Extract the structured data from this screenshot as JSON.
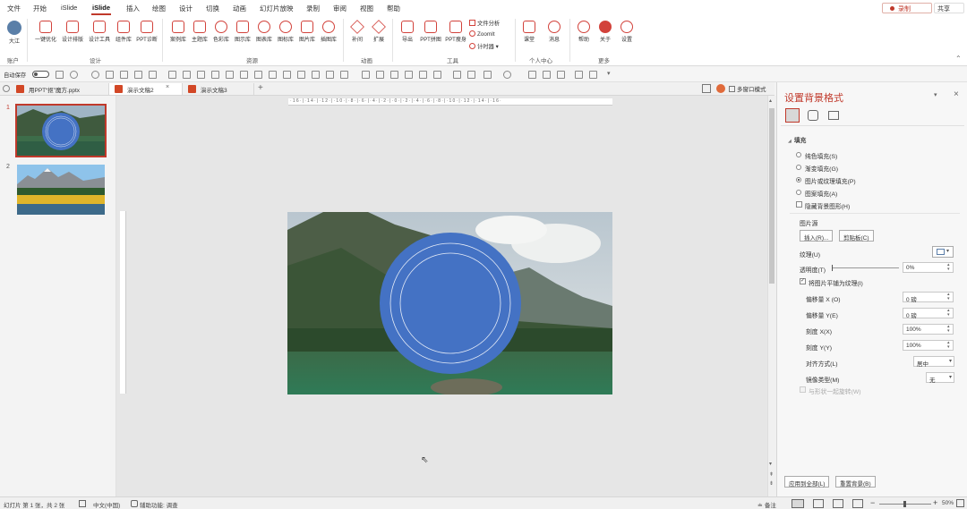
{
  "menu": {
    "tabs": [
      "文件",
      "开始",
      "iSlide",
      "iSlide",
      "插入",
      "绘图",
      "设计",
      "切换",
      "动画",
      "幻灯片放映",
      "录制",
      "审阅",
      "视图",
      "帮助"
    ],
    "record": "录制",
    "share": "共享"
  },
  "ribbon": {
    "account_btn": "大江",
    "buttons": [
      "一键优化",
      "设计排版",
      "设计工具",
      "组件库",
      "PPT诊断",
      "案例库",
      "主题库",
      "色彩库",
      "图示库",
      "图表库",
      "图标库",
      "图片库",
      "插图库",
      "补间",
      "扩展",
      "导出",
      "PPT拼图",
      "PPT瘦身",
      "课堂",
      "消息",
      "帮助",
      "关于",
      "设置"
    ],
    "small_buttons": [
      "文件分析",
      "ZoomIt",
      "计时器"
    ],
    "groups": [
      "账户",
      "设计",
      "资源",
      "动画",
      "工具",
      "个人中心",
      "更多"
    ]
  },
  "qat": {
    "autosave": "自动保存"
  },
  "doc_tabs": [
    "用PPT“抠”魔方.pptx",
    "演示文稿2",
    "演示文稿3"
  ],
  "multi_window": "多窗口模式",
  "slides_panel": {
    "numbers": [
      "1",
      "2"
    ]
  },
  "ruler": {
    "h": "·16·|·14·|·12·|·10·|·8·|·6·|·4·|·2·|·0·|·2·|·4·|·6·|·8·|·10·|·12·|·14·|·16·"
  },
  "pane": {
    "title": "设置背景格式",
    "section": "填充",
    "fill_options": [
      "纯色填充(S)",
      "渐变填充(G)",
      "图片或纹理填充(P)",
      "图案填充(A)"
    ],
    "hide_bg": "隐藏背景图形(H)",
    "picture_source": "图片源",
    "insert_btn": "插入(R)...",
    "clipboard_btn": "剪贴板(C)",
    "texture": "纹理(U)",
    "transparency": "透明度(T)",
    "transparency_val": "0%",
    "tile": "将图片平铺为纹理(I)",
    "offset_x": "偏移量 X (O)",
    "offset_x_val": "0 磅",
    "offset_y": "偏移量 Y(E)",
    "offset_y_val": "0 磅",
    "scale_x": "刻度 X(X)",
    "scale_x_val": "100%",
    "scale_y": "刻度 Y(Y)",
    "scale_y_val": "100%",
    "align": "对齐方式(L)",
    "align_val": "居中",
    "mirror": "镜像类型(M)",
    "mirror_val": "无",
    "rotate": "与形状一起旋转(W)",
    "apply_all": "应用到全部(L)",
    "reset": "重置背景(B)"
  },
  "status": {
    "slide_info": "幻灯片 第 1 张，共 2 张",
    "lang": "中文(中国)",
    "accessibility": "辅助功能: 调查",
    "notes": "备注",
    "zoom": "50%"
  },
  "colors": {
    "accent": "#c0392b",
    "circle": "#4472c4"
  }
}
